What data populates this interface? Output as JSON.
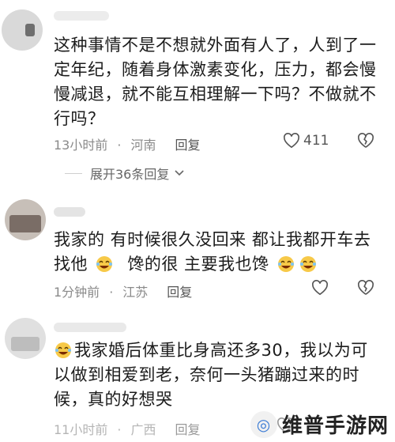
{
  "comments": [
    {
      "text": "这种事情不是不想就外面有人了，人到了一定年纪，随着身体激素变化，压力，都会慢慢减退，就不能互相理解一下吗？不做就不行吗？",
      "time": "13小时前",
      "location": "河南",
      "reply_label": "回复",
      "likes": "411",
      "expand_label": "展开36条回复"
    },
    {
      "text_parts": [
        "我家的 有时候很久没回来 都让我都开车去找他",
        "馋的很 主要我也馋"
      ],
      "time": "1分钟前",
      "location": "江苏",
      "reply_label": "回复"
    },
    {
      "text": "我家婚后体重比身高还多30，我以为可以做到相爱到老，奈何一头猪蹦过来的时候，真的好想哭",
      "time": "11小时前",
      "location": "广西",
      "reply_label": "回复"
    }
  ],
  "watermark": {
    "text": "维普手游网"
  },
  "colors": {
    "meta": "#8a8a8a",
    "text": "#1c1c1c",
    "emoji": "#f7c948"
  }
}
